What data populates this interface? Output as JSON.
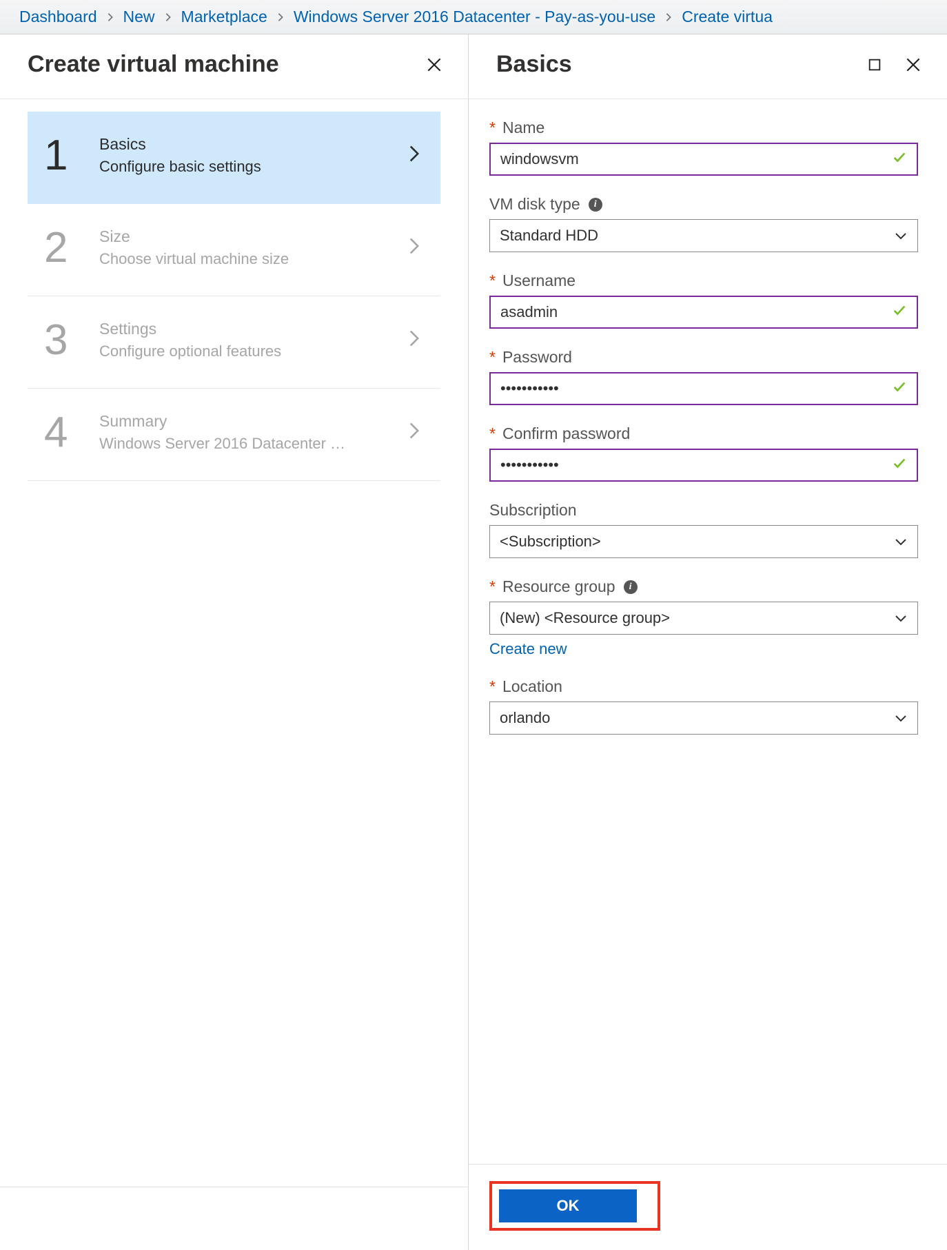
{
  "breadcrumb": {
    "items": [
      {
        "label": "Dashboard"
      },
      {
        "label": "New"
      },
      {
        "label": "Marketplace"
      },
      {
        "label": "Windows Server 2016 Datacenter - Pay-as-you-use"
      },
      {
        "label": "Create virtua"
      }
    ]
  },
  "left_pane": {
    "title": "Create virtual machine",
    "steps": [
      {
        "num": "1",
        "title": "Basics",
        "subtitle": "Configure basic settings",
        "active": true
      },
      {
        "num": "2",
        "title": "Size",
        "subtitle": "Choose virtual machine size",
        "active": false
      },
      {
        "num": "3",
        "title": "Settings",
        "subtitle": "Configure optional features",
        "active": false
      },
      {
        "num": "4",
        "title": "Summary",
        "subtitle": "Windows Server 2016 Datacenter …",
        "active": false
      }
    ]
  },
  "right_pane": {
    "title": "Basics",
    "form": {
      "name": {
        "label": "Name",
        "required": true,
        "value": "windowsvm",
        "valid": true
      },
      "disk_type": {
        "label": "VM disk type",
        "info": true,
        "value": "Standard HDD"
      },
      "username": {
        "label": "Username",
        "required": true,
        "value": "asadmin",
        "valid": true
      },
      "password": {
        "label": "Password",
        "required": true,
        "value": "•••••••••••",
        "valid": true
      },
      "confirm_password": {
        "label": "Confirm password",
        "required": true,
        "value": "•••••••••••",
        "valid": true
      },
      "subscription": {
        "label": "Subscription",
        "value": "<Subscription>"
      },
      "resource_group": {
        "label": "Resource group",
        "required": true,
        "info": true,
        "value": "(New)  <Resource group>",
        "create_new": "Create new"
      },
      "location": {
        "label": "Location",
        "required": true,
        "value": "orlando"
      }
    },
    "ok_button": "OK"
  }
}
